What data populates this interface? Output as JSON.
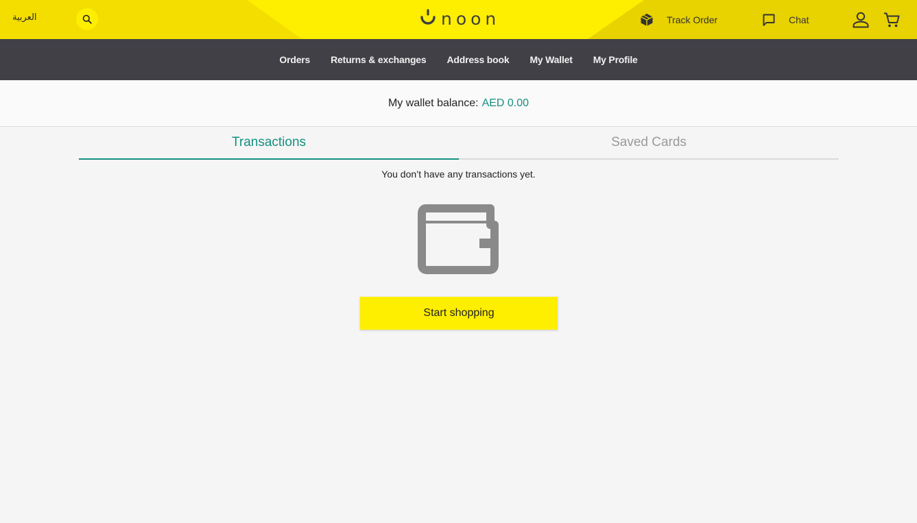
{
  "header": {
    "language_link": "العربية",
    "logo_text": "noon",
    "track_order_label": "Track Order",
    "chat_label": "Chat",
    "icons": {
      "search": "search-icon",
      "track_order": "package-icon",
      "chat": "chat-bubble-icon",
      "user": "user-icon",
      "cart": "cart-icon"
    }
  },
  "account_nav": {
    "items": [
      {
        "label": "Orders"
      },
      {
        "label": "Returns & exchanges"
      },
      {
        "label": "Address book"
      },
      {
        "label": "My Wallet"
      },
      {
        "label": "My Profile"
      }
    ]
  },
  "wallet": {
    "balance_label": "My wallet balance:",
    "balance_amount": "AED 0.00"
  },
  "tabs": [
    {
      "label": "Transactions",
      "active": true
    },
    {
      "label": "Saved Cards",
      "active": false
    }
  ],
  "empty_state": {
    "message": "You don’t have any transactions yet.",
    "icon": "wallet-icon",
    "button_label": "Start shopping"
  },
  "colors": {
    "brand_yellow": "#feee00",
    "nav_bg": "#404046",
    "accent_teal": "#149080",
    "icon_gray": "#8a8a8a"
  }
}
